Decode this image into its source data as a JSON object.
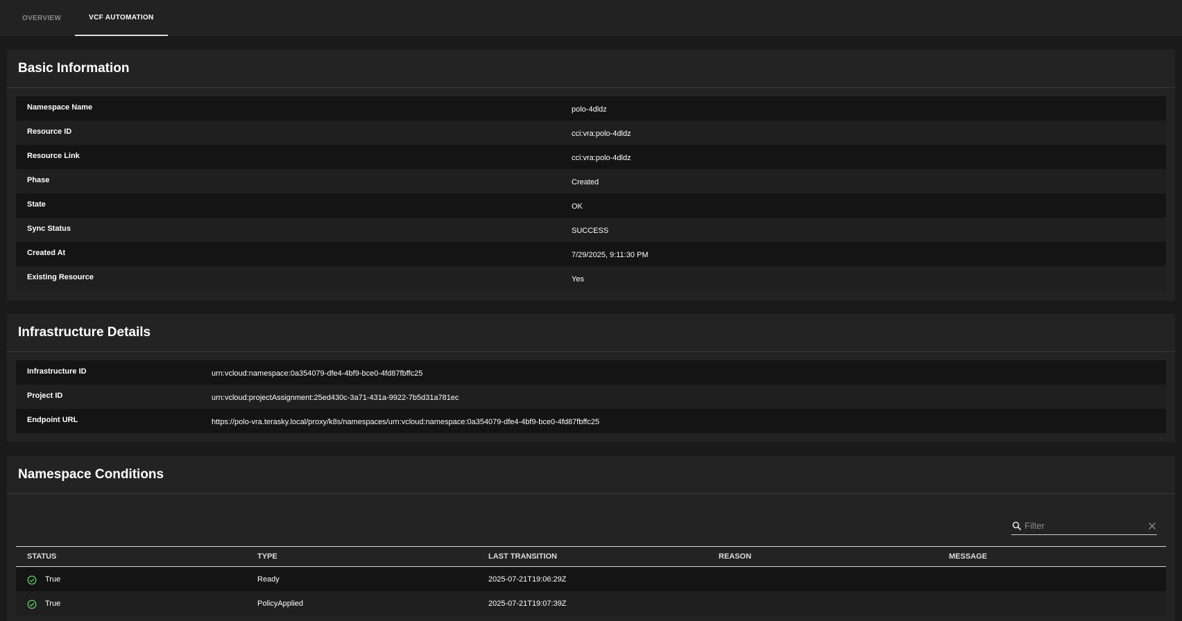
{
  "tabs": [
    {
      "label": "OVERVIEW"
    },
    {
      "label": "VCF AUTOMATION"
    }
  ],
  "basic_info": {
    "title": "Basic Information",
    "rows": [
      {
        "key": "Namespace Name",
        "value": "polo-4dldz"
      },
      {
        "key": "Resource ID",
        "value": "cci:vra:polo-4dldz"
      },
      {
        "key": "Resource Link",
        "value": "cci:vra:polo-4dldz"
      },
      {
        "key": "Phase",
        "value": "Created"
      },
      {
        "key": "State",
        "value": "OK"
      },
      {
        "key": "Sync Status",
        "value": "SUCCESS"
      },
      {
        "key": "Created At",
        "value": "7/29/2025, 9:11:30 PM"
      },
      {
        "key": "Existing Resource",
        "value": "Yes"
      }
    ]
  },
  "infra": {
    "title": "Infrastructure Details",
    "rows": [
      {
        "key": "Infrastructure ID",
        "value": "urn:vcloud:namespace:0a354079-dfe4-4bf9-bce0-4fd87fbffc25"
      },
      {
        "key": "Project ID",
        "value": "urn:vcloud:projectAssignment:25ed430c-3a71-431a-9922-7b5d31a781ec"
      },
      {
        "key": "Endpoint URL",
        "value": "https://polo-vra.terasky.local/proxy/k8s/namespaces/urn:vcloud:namespace:0a354079-dfe4-4bf9-bce0-4fd87fbffc25"
      }
    ]
  },
  "conditions": {
    "title": "Namespace Conditions",
    "filter_placeholder": "Filter",
    "columns": [
      "STATUS",
      "TYPE",
      "LAST TRANSITION",
      "REASON",
      "MESSAGE"
    ],
    "rows": [
      {
        "status": "True",
        "type": "Ready",
        "last_transition": "2025-07-21T19:06:29Z",
        "reason": "",
        "message": ""
      },
      {
        "status": "True",
        "type": "PolicyApplied",
        "last_transition": "2025-07-21T19:07:39Z",
        "reason": "",
        "message": ""
      }
    ]
  },
  "colors": {
    "background": "#1a1a1a",
    "panel": "#232323",
    "row_dark": "#141414",
    "row_light": "#1f1f1f",
    "success": "#5fbf6a"
  }
}
